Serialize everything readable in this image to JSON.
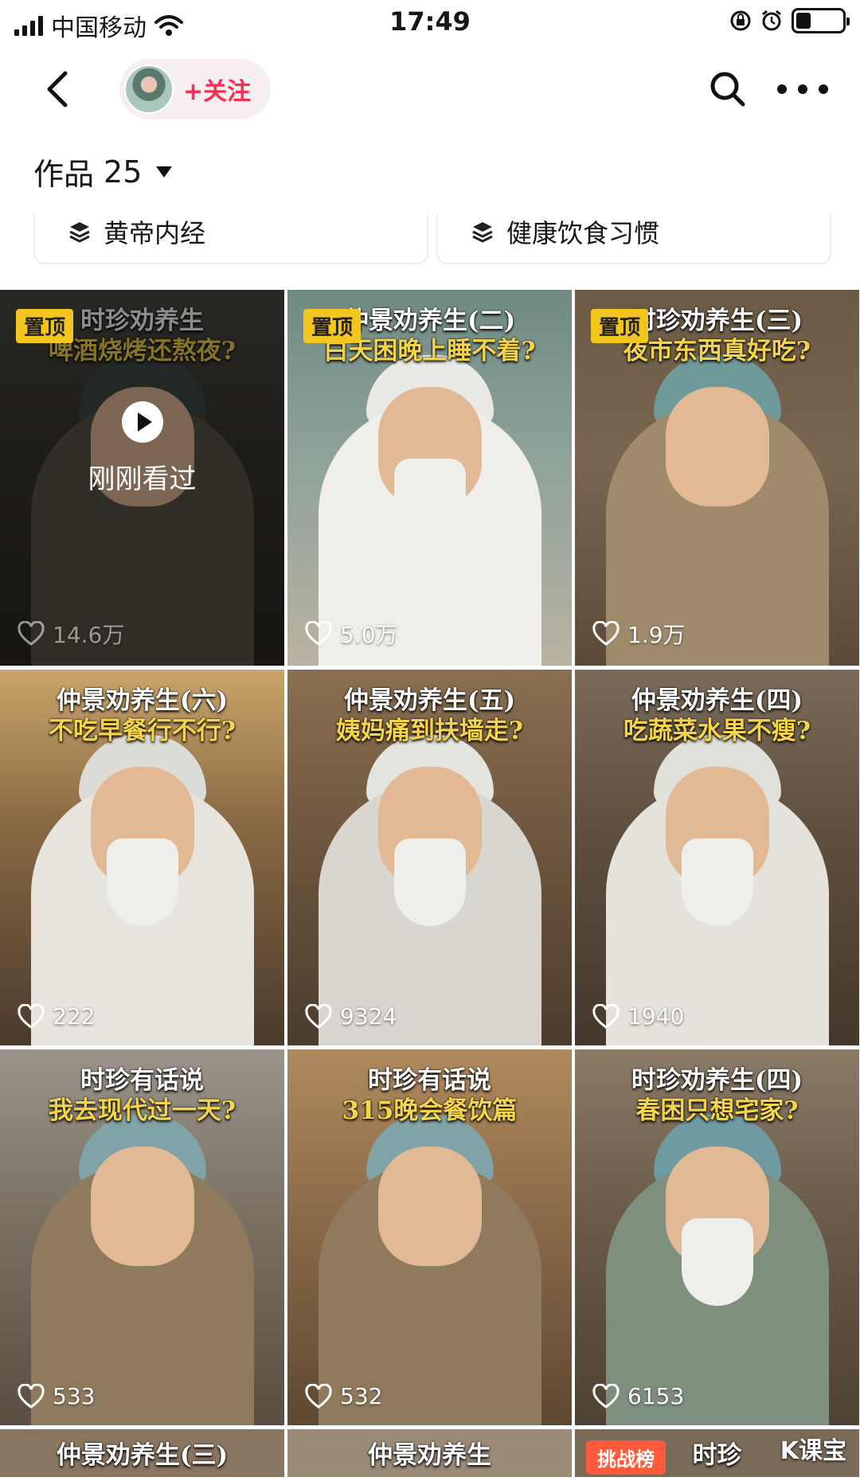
{
  "status_bar": {
    "carrier": "中国移动",
    "time": "17:49"
  },
  "nav": {
    "follow_label": "+关注"
  },
  "works": {
    "label": "作品",
    "count": "25"
  },
  "collections": [
    {
      "title": "黄帝内经"
    },
    {
      "title": "健康饮食习惯"
    }
  ],
  "videos": [
    {
      "line1": "时珍劝养生",
      "line2": "啤酒烧烤还熬夜?",
      "likes": "14.6万",
      "pinned": true,
      "pin_label": "置顶",
      "watched": true,
      "watched_label": "刚刚看过"
    },
    {
      "line1": "仲景劝养生(二)",
      "line2": "白天困晚上睡不着?",
      "likes": "5.0万",
      "pinned": true,
      "pin_label": "置顶"
    },
    {
      "line1": "时珍劝养生(三)",
      "line2": "夜市东西真好吃?",
      "likes": "1.9万",
      "pinned": true,
      "pin_label": "置顶"
    },
    {
      "line1": "仲景劝养生(六)",
      "line2": "不吃早餐行不行?",
      "likes": "222"
    },
    {
      "line1": "仲景劝养生(五)",
      "line2": "姨妈痛到扶墙走?",
      "likes": "9324"
    },
    {
      "line1": "仲景劝养生(四)",
      "line2": "吃蔬菜水果不瘦?",
      "likes": "1940"
    },
    {
      "line1": "时珍有话说",
      "line2": "我去现代过一天?",
      "likes": "533"
    },
    {
      "line1": "时珍有话说",
      "line2": "315晚会餐饮篇",
      "likes": "532"
    },
    {
      "line1": "时珍劝养生(四)",
      "line2": "春困只想宅家?",
      "likes": "6153"
    }
  ],
  "partial_row": [
    {
      "line1": "仲景劝养生(三)"
    },
    {
      "line1": "仲景劝养生"
    },
    {
      "line1": "时珍",
      "badge": "挑战榜",
      "watermark": "K课宝"
    }
  ],
  "colors": {
    "accent": "#fe2c55",
    "pin": "#f2c61f",
    "caption_yellow": "#f3d44a"
  },
  "icons": [
    "back-icon",
    "search-icon",
    "more-icon",
    "stack-icon",
    "heart-icon",
    "play-icon"
  ]
}
